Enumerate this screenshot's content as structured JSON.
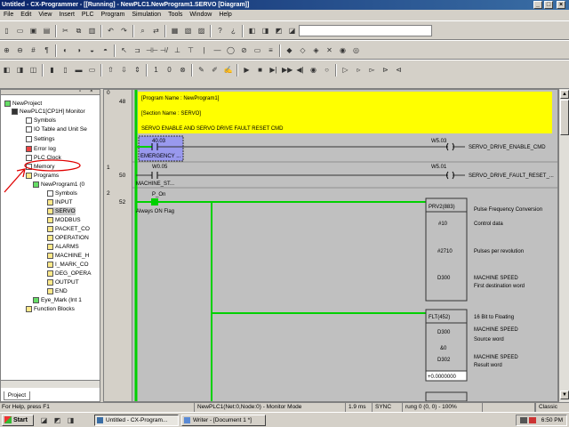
{
  "window": {
    "title": "Untitled - CX-Programmer - [[Running] - NewPLC1.NewProgram1.SERVO [Diagram]]"
  },
  "menu": [
    "File",
    "Edit",
    "View",
    "Insert",
    "PLC",
    "Program",
    "Simulation",
    "Tools",
    "Window",
    "Help"
  ],
  "tree": {
    "items": [
      {
        "label": "NewProject",
        "icon": "project-icon"
      },
      {
        "label": "NewPLC1[CP1H] Monitor",
        "icon": "plc-icon"
      },
      {
        "label": "Symbols",
        "icon": "symbols-icon"
      },
      {
        "label": "IO Table and Unit Se",
        "icon": "io-table-icon"
      },
      {
        "label": "Settings",
        "icon": "settings-icon"
      },
      {
        "label": "Error log",
        "icon": "error-log-icon"
      },
      {
        "label": "PLC Clock",
        "icon": "clock-icon"
      },
      {
        "label": "Memory",
        "icon": "memory-icon"
      },
      {
        "label": "Programs",
        "icon": "folder-icon"
      },
      {
        "label": "NewProgram1 (0",
        "icon": "program-icon"
      },
      {
        "label": "Symbols",
        "icon": "symbols-icon"
      },
      {
        "label": "INPUT",
        "icon": "section-icon"
      },
      {
        "label": "SERVO",
        "icon": "section-icon"
      },
      {
        "label": "MODBUS",
        "icon": "section-icon"
      },
      {
        "label": "PACKET_CO",
        "icon": "section-icon"
      },
      {
        "label": "OPERATION",
        "icon": "section-icon"
      },
      {
        "label": "ALARMS",
        "icon": "section-icon"
      },
      {
        "label": "MACHINE_H",
        "icon": "section-icon"
      },
      {
        "label": "I_MARK_CO",
        "icon": "section-icon"
      },
      {
        "label": "DEG_OPERA",
        "icon": "section-icon"
      },
      {
        "label": "OUTPUT",
        "icon": "section-icon"
      },
      {
        "label": "END",
        "icon": "section-icon"
      },
      {
        "label": "Eye_Mark (Int 1",
        "icon": "program-icon"
      },
      {
        "label": "Function Blocks",
        "icon": "function-block-icon"
      }
    ],
    "tab_label": "Project"
  },
  "ladder": {
    "rung0": {
      "num": "0",
      "step": "48",
      "program_name": "[Program Name : NewProgram1]",
      "section_name": "[Section Name : SERVO]",
      "comment": "SERVO ENABLE AND SERVO DRIVE FAULT RESET CMD",
      "contact_addr": "40.03",
      "contact_comment": "EMERGENCY ...",
      "coil_addr": "W5.03",
      "coil_comment": "SERVO_DRIVE_ENABLE_CMD"
    },
    "rung1": {
      "num": "1",
      "step": "50",
      "contact_addr": "W0.05",
      "contact_comment": "MACHINE_ST...",
      "coil_addr": "W5.01",
      "coil_comment": "SERVO_DRIVE_FAULT_RESET_..."
    },
    "rung2": {
      "num": "2",
      "step": "52",
      "contact_addr": "P_On",
      "contact_comment": "Always ON Flag",
      "fb1": {
        "name": "PRV2(883)",
        "desc": "Pulse Frequency Conversion",
        "op1": "#10",
        "op1_desc": "Control data",
        "op2": "#2710",
        "op2_desc": "Pulses per revolution",
        "op3": "D300",
        "op3_desc1": "MACHINE SPEED",
        "op3_desc2": "First destination word"
      },
      "fb2": {
        "name": "FLT(452)",
        "desc": "16 Bit to Floating",
        "op1a": "MACHINE SPEED",
        "op1": "D300",
        "op1_desc1": "MACHINE SPEED",
        "op1_desc2": "Source word",
        "op2a": "&0",
        "op2": "D302",
        "op2_desc1": "MACHINE SPEED",
        "op2_desc2": "Result word",
        "value": "+0.0000000"
      }
    }
  },
  "status": {
    "help": "For Help, press F1",
    "plc": "NewPLC1(Net:0,Node:0) - Monitor Mode",
    "cycle": "1.9 ms",
    "sync": "SYNC",
    "rung": "rung 0 (0, 0) - 100%",
    "style": "Classic"
  },
  "taskbar": {
    "start": "Start",
    "tasks": [
      "Untitled - CX-Program...",
      "Writer - [Document 1 *]"
    ],
    "clock": "6:50 PM"
  },
  "colors": {
    "rung_power": "#00d000",
    "comment_bg": "#ffff00",
    "highlight_contact": "#9999ee",
    "annotation": "#e00000"
  }
}
